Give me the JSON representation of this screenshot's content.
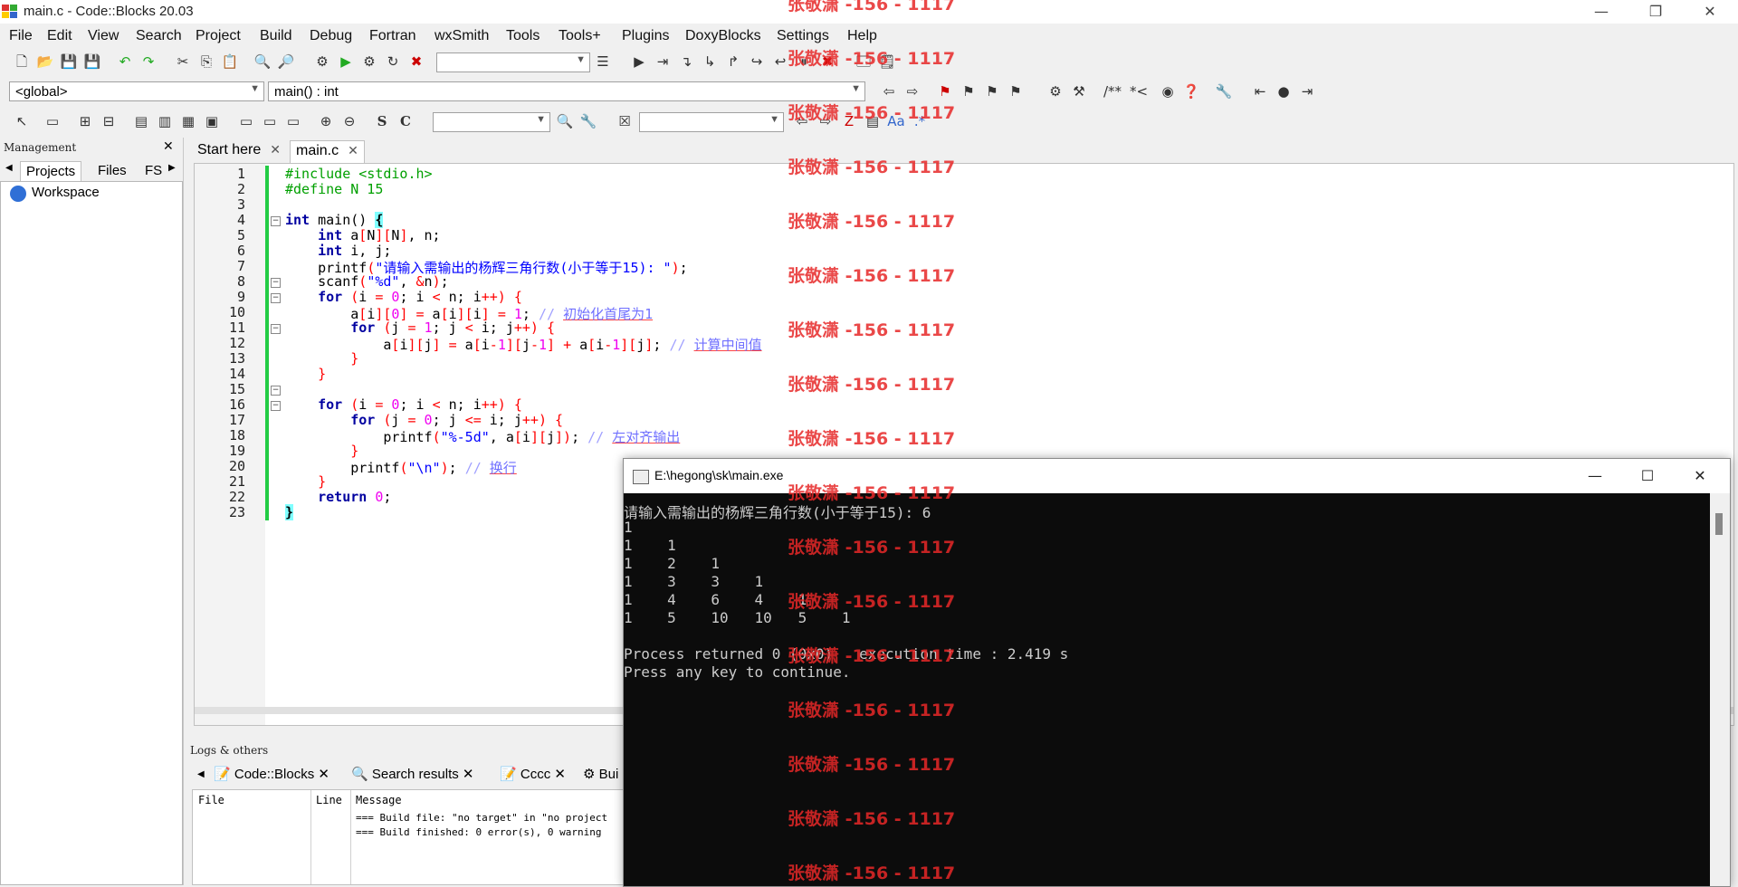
{
  "window": {
    "title": "main.c - Code::Blocks 20.03"
  },
  "menu": [
    "File",
    "Edit",
    "View",
    "Search",
    "Project",
    "Build",
    "Debug",
    "Fortran",
    "wxSmith",
    "Tools",
    "Tools+",
    "Plugins",
    "DoxyBlocks",
    "Settings",
    "Help"
  ],
  "toolbar": {
    "scope_combo": "<global>",
    "function_combo": "main() : int",
    "comment_btn": "/**",
    "comment_btn2": "*<"
  },
  "management": {
    "header": "Management",
    "tabs": [
      "Projects",
      "Files",
      "FS"
    ],
    "tree_root": "Workspace"
  },
  "editor": {
    "tabs": [
      {
        "label": "Start here"
      },
      {
        "label": "main.c"
      }
    ],
    "line_numbers": [
      "1",
      "2",
      "3",
      "4",
      "5",
      "6",
      "7",
      "8",
      "9",
      "10",
      "11",
      "12",
      "13",
      "14",
      "15",
      "16",
      "17",
      "18",
      "19",
      "20",
      "21",
      "22",
      "23"
    ]
  },
  "logs": {
    "header": "Logs & others",
    "tabs": [
      "Code::Blocks",
      "Search results",
      "Cccc",
      "Bui"
    ],
    "columns": [
      "File",
      "Line",
      "Message"
    ],
    "messages": [
      "=== Build file: \"no target\" in \"no project",
      "=== Build finished: 0 error(s), 0 warning"
    ]
  },
  "console": {
    "title": "E:\\hegong\\sk\\main.exe",
    "lines": [
      "请输入需输出的杨辉三角行数(小于等于15): 6",
      "1",
      "1    1",
      "1    2    1",
      "1    3    3    1",
      "1    4    6    4    1",
      "1    5    10   10   5    1",
      "",
      "Process returned 0 (0x0)   execution time : 2.419 s",
      "Press any key to continue."
    ]
  },
  "watermark": {
    "text": "张敬潇 -156 - 1117"
  },
  "colors": {
    "change_bar": "#22cc44",
    "watermark": "#e62828",
    "console_bg": "#0c0c0c"
  }
}
